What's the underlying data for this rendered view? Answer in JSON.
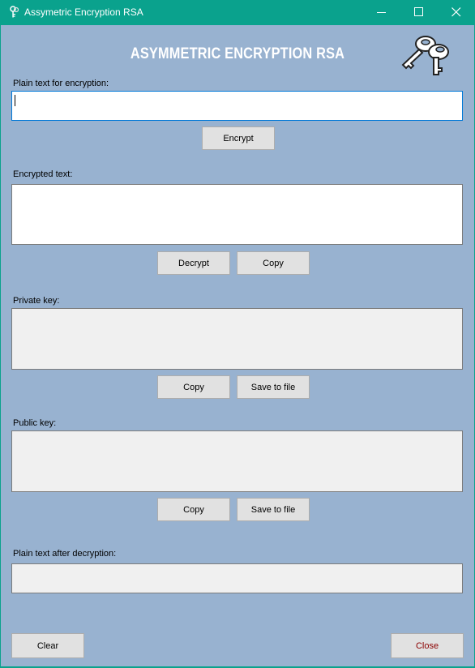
{
  "window": {
    "title": "Assymetric Encryption RSA"
  },
  "heading": "ASYMMETRIC ENCRYPTION RSA",
  "plain_text": {
    "label": "Plain text for encryption:",
    "value": ""
  },
  "encrypt_button": "Encrypt",
  "encrypted_text": {
    "label": "Encrypted text:",
    "value": ""
  },
  "decrypt_button": "Decrypt",
  "copy_encrypted_button": "Copy",
  "private_key": {
    "label": "Private key:",
    "value": "",
    "copy_button": "Copy",
    "save_button": "Save to file"
  },
  "public_key": {
    "label": "Public key:",
    "value": "",
    "copy_button": "Copy",
    "save_button": "Save to file"
  },
  "decrypted_text": {
    "label": "Plain text after decryption:",
    "value": ""
  },
  "clear_button": "Clear",
  "close_button": "Close",
  "colors": {
    "titlebar": "#0aa28d",
    "form_background": "#98b2d0",
    "heading": "#ffffff",
    "close_text": "#8b0000"
  },
  "icons": {
    "app": "keys-icon",
    "logo": "keys-icon"
  }
}
